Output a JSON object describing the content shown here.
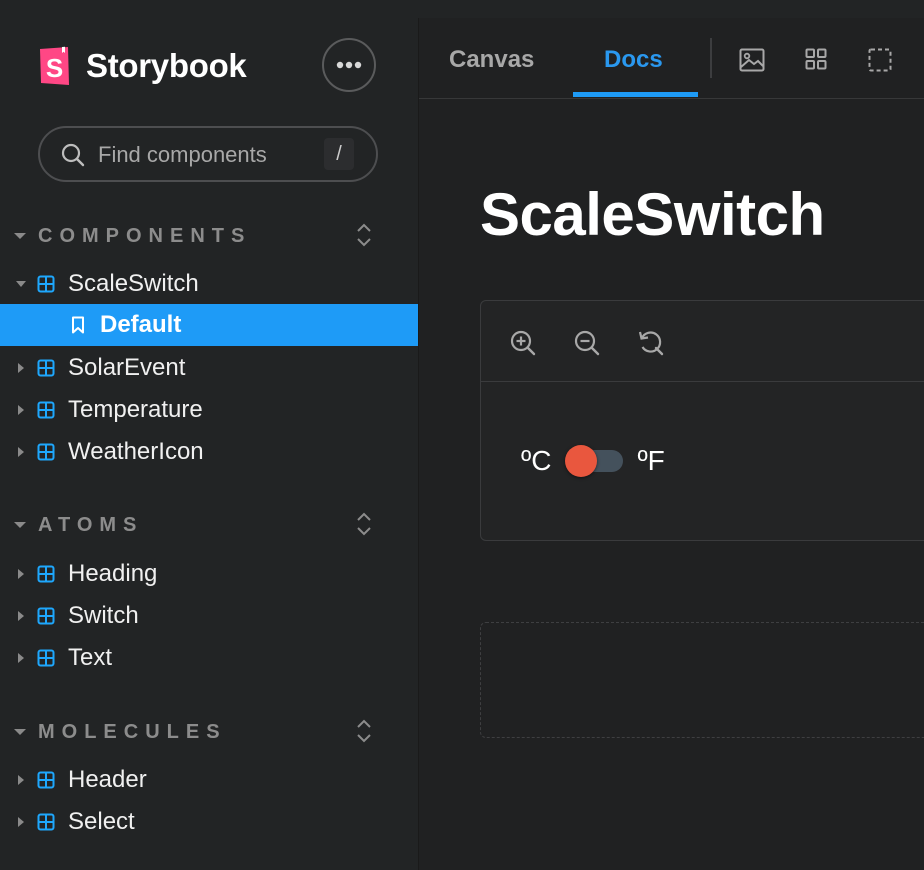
{
  "app": {
    "name": "Storybook",
    "brand_color": "#FF4785",
    "accent_color": "#1EA7FD"
  },
  "search": {
    "placeholder": "Find components",
    "shortcut": "/"
  },
  "sidebar": {
    "sections": [
      {
        "label": "COMPONENTS",
        "items": [
          {
            "label": "ScaleSwitch",
            "expanded": true,
            "children": [
              {
                "label": "Default",
                "selected": true
              }
            ]
          },
          {
            "label": "SolarEvent"
          },
          {
            "label": "Temperature"
          },
          {
            "label": "WeatherIcon"
          }
        ]
      },
      {
        "label": "ATOMS",
        "items": [
          {
            "label": "Heading"
          },
          {
            "label": "Switch"
          },
          {
            "label": "Text"
          }
        ]
      },
      {
        "label": "MOLECULES",
        "items": [
          {
            "label": "Header"
          },
          {
            "label": "Select"
          }
        ]
      }
    ]
  },
  "tabs": [
    {
      "label": "Canvas",
      "active": false
    },
    {
      "label": "Docs",
      "active": true
    }
  ],
  "toolbar_icons": [
    "image-icon",
    "grid-icon",
    "outline-icon"
  ],
  "doc": {
    "title": "ScaleSwitch",
    "preview_toolbar": [
      "zoom-in-icon",
      "zoom-out-icon",
      "zoom-reset-icon"
    ],
    "switch": {
      "left_label": "ºC",
      "right_label": "ºF",
      "knob_color": "#E9573E"
    }
  }
}
